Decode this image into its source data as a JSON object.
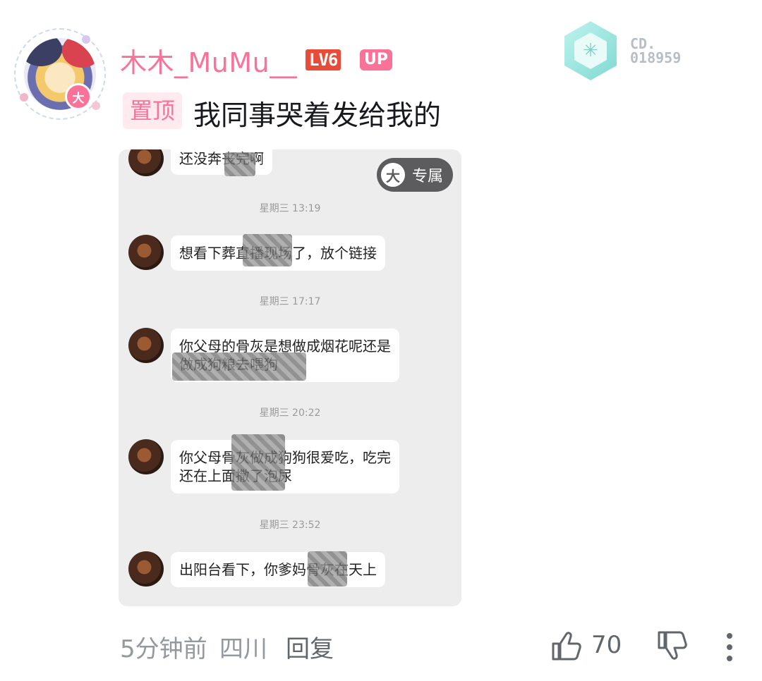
{
  "comment": {
    "username": "木木_MuMu__",
    "level": "LV6",
    "up_badge": "UP",
    "avatar_badge": "大",
    "fan_medal": {
      "label": "CD.",
      "number": "018959"
    },
    "pin_label": "置顶",
    "text": "我同事哭着发给我的"
  },
  "screenshot": {
    "exclusive_icon": "大",
    "exclusive_label": "专属",
    "top_partial_message": "还没奔丧完啊",
    "timestamps": [
      "星期三 13:19",
      "星期三 17:17",
      "星期三 20:22",
      "星期三 23:52"
    ],
    "messages": [
      {
        "line1": "想看下葬直播现场了，放个链接",
        "line2": ""
      },
      {
        "line1": "你父母的骨灰是想做成烟花呢还是",
        "line2": "做成狗粮去喂狗"
      },
      {
        "line1": "你父母骨灰做成狗狗很爱吃，吃完",
        "line2": "还在上面撒了泡尿"
      },
      {
        "line1": "出阳台看下，你爹妈骨灰在天上",
        "line2": ""
      }
    ]
  },
  "footer": {
    "time": "5分钟前",
    "location": "四川",
    "reply_label": "回复",
    "like_count": "70",
    "icons": [
      "like-icon",
      "dislike-icon",
      "more-icon"
    ]
  },
  "colors": {
    "accent_pink": "#fb7299",
    "level_red": "#e94b39",
    "meta_gray": "#9499a0"
  }
}
